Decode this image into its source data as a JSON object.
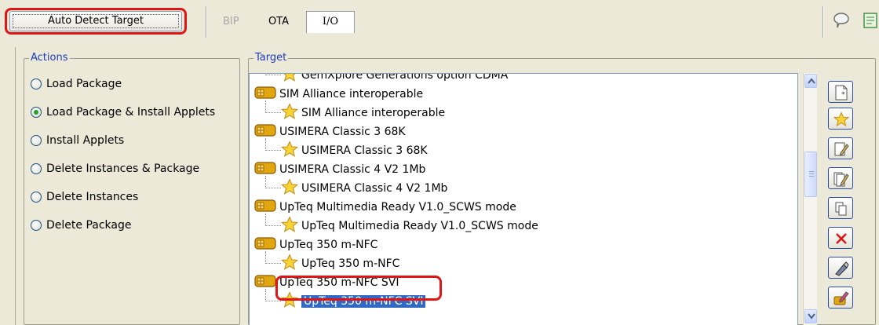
{
  "toolbar": {
    "auto_detect_label": "Auto Detect Target",
    "tabs": [
      "BIP",
      "OTA",
      "I/O"
    ],
    "active_tab": "I/O"
  },
  "actions": {
    "legend": "Actions",
    "options": [
      "Load Package",
      "Load Package & Install Applets",
      "Install Applets",
      "Delete Instances & Package",
      "Delete Instances",
      "Delete Package"
    ],
    "selected": "Load Package & Install Applets"
  },
  "target": {
    "legend": "Target",
    "tree": [
      {
        "level": 1,
        "label": "GemXplore Generations option CDMA",
        "icon": "star-icon"
      },
      {
        "level": 0,
        "label": "SIM Alliance interoperable",
        "icon": "card-icon"
      },
      {
        "level": 1,
        "label": "SIM Alliance interoperable",
        "icon": "star-icon"
      },
      {
        "level": 0,
        "label": "USIMERA Classic 3 68K",
        "icon": "card-icon"
      },
      {
        "level": 1,
        "label": "USIMERA Classic 3 68K",
        "icon": "star-icon"
      },
      {
        "level": 0,
        "label": "USIMERA Classic 4 V2 1Mb",
        "icon": "card-icon"
      },
      {
        "level": 1,
        "label": "USIMERA Classic 4 V2 1Mb",
        "icon": "star-icon"
      },
      {
        "level": 0,
        "label": "UpTeq Multimedia Ready V1.0_SCWS mode",
        "icon": "card-icon"
      },
      {
        "level": 1,
        "label": "UpTeq Multimedia Ready V1.0_SCWS mode",
        "icon": "star-icon"
      },
      {
        "level": 0,
        "label": "UpTeq 350 m-NFC",
        "icon": "card-icon"
      },
      {
        "level": 1,
        "label": "UpTeq 350 m-NFC",
        "icon": "star-icon"
      },
      {
        "level": 0,
        "label": "UpTeq 350 m-NFC SVI",
        "icon": "card-icon"
      },
      {
        "level": 1,
        "label": "UpTeq 350 m-NFC SVI",
        "icon": "star-icon",
        "selected": true
      }
    ],
    "side_buttons": [
      "new-document-icon",
      "star-icon",
      "edit-icon",
      "edit-multiple-icon",
      "copy-icon",
      "delete-icon",
      "pencil-eraser-icon",
      "card-edit-icon"
    ]
  },
  "colors": {
    "highlight_red": "#e01515",
    "selection_blue": "#316ac5",
    "legend_blue": "#1a3cbf",
    "window_bg": "#ece9d8"
  }
}
